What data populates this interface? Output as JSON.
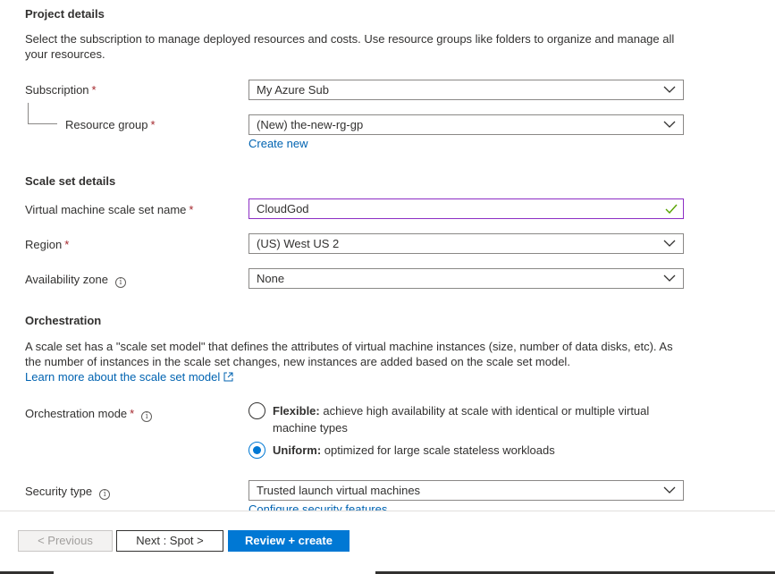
{
  "project_details": {
    "heading": "Project details",
    "description": "Select the subscription to manage deployed resources and costs. Use resource groups like folders to organize and manage all your resources.",
    "subscription_label": "Subscription",
    "subscription_value": "My Azure Sub",
    "resource_group_label": "Resource group",
    "resource_group_value": "(New) the-new-rg-gp",
    "create_new_link": "Create new",
    "required_marker": "*"
  },
  "scale_set_details": {
    "heading": "Scale set details",
    "name_label": "Virtual machine scale set name",
    "name_value": "CloudGod",
    "region_label": "Region",
    "region_value": "(US) West US 2",
    "availability_zone_label": "Availability zone",
    "availability_zone_value": "None"
  },
  "orchestration": {
    "heading": "Orchestration",
    "description": "A scale set has a \"scale set model\" that defines the attributes of virtual machine instances (size, number of data disks, etc). As the number of instances in the scale set changes, new instances are added based on the scale set model.",
    "learn_more_link": "Learn more about the scale set model",
    "mode_label": "Orchestration mode",
    "flexible_title": "Flexible:",
    "flexible_desc": "achieve high availability at scale with identical or multiple virtual machine types",
    "uniform_title": "Uniform:",
    "uniform_desc": "optimized for large scale stateless workloads",
    "selected_mode": "Uniform"
  },
  "security": {
    "type_label": "Security type",
    "type_value": "Trusted launch virtual machines",
    "configure_link": "Configure security features"
  },
  "footer": {
    "previous_label": "< Previous",
    "next_label": "Next : Spot >",
    "review_label": "Review + create"
  },
  "colors": {
    "accent": "#0078d4",
    "link": "#0063b1",
    "required": "#a4262c",
    "valid_check": "#57a300",
    "focused_border": "#8c2ec4"
  }
}
